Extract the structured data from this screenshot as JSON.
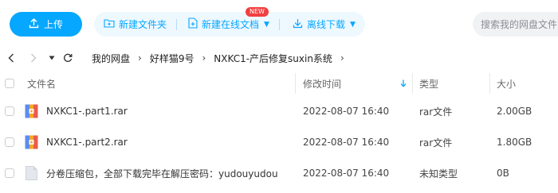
{
  "toolbar": {
    "upload_label": "上传",
    "new_folder_label": "新建文件夹",
    "new_doc_label": "新建在线文档",
    "new_badge": "NEW",
    "offline_download_label": "离线下载"
  },
  "search": {
    "placeholder": "搜索我的网盘文件"
  },
  "breadcrumb": {
    "items": [
      "我的网盘",
      "好样猫9号",
      "NXKC1-产后修复suxin系统"
    ]
  },
  "table": {
    "headers": {
      "name": "文件名",
      "modified": "修改时间",
      "type": "类型",
      "size": "大小"
    },
    "sort_icon": "arrow-down-icon",
    "rows": [
      {
        "name": "NXKC1-.part1.rar",
        "modified": "2022-08-07 16:40",
        "type": "rar文件",
        "size": "2.00GB",
        "icon": "rar-archive-icon"
      },
      {
        "name": "NXKC1-.part2.rar",
        "modified": "2022-08-07 16:40",
        "type": "rar文件",
        "size": "1.80GB",
        "icon": "rar-archive-icon"
      },
      {
        "name": "分卷压缩包，全部下载完毕在解压密码：yudouyudou",
        "modified": "2022-08-07 16:40",
        "type": "未知类型",
        "size": "0B",
        "icon": "unknown-file-icon"
      }
    ]
  },
  "colors": {
    "accent": "#06a7ff",
    "badge": "#f23f3f",
    "action_bg": "#eef8ff"
  }
}
